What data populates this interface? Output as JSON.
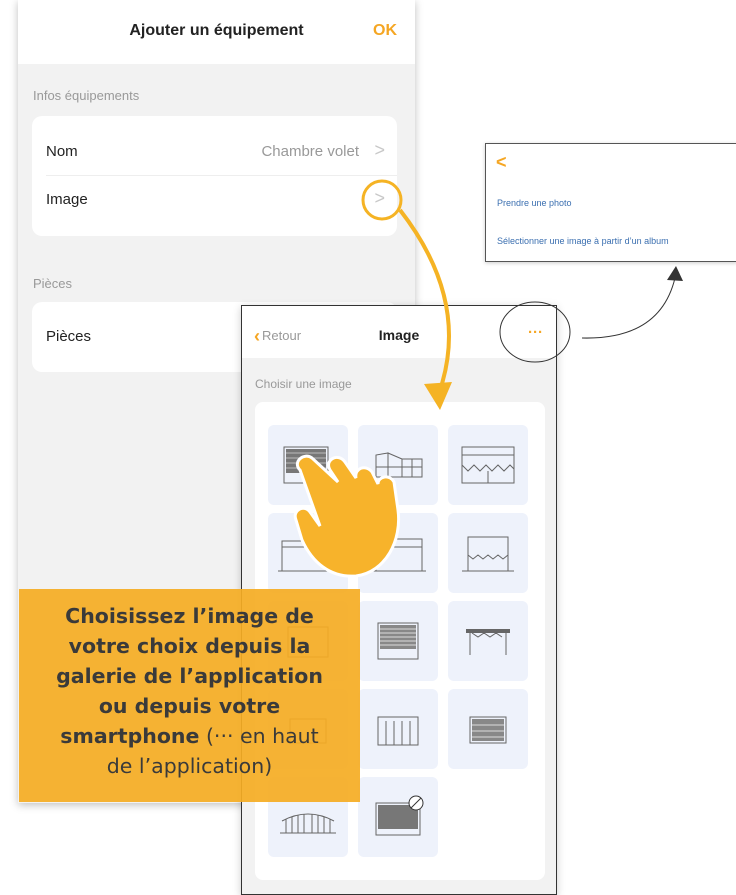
{
  "screen_add": {
    "title": "Ajouter un équipement",
    "ok_label": "OK",
    "section_info": "Infos équipements",
    "name_label": "Nom",
    "name_value": "Chambre volet",
    "image_label": "Image",
    "section_rooms": "Pièces",
    "rooms_label": "Pièces",
    "chevron": ">"
  },
  "screen_image": {
    "back_label": "Retour",
    "title": "Image",
    "more_label": "···",
    "subtitle": "Choisir une image",
    "tiles": [
      "roller-shutter",
      "bay-windows",
      "awning-window",
      "window-with-shutter",
      "sliding-door",
      "awning-low",
      "shutter-left",
      "venetian-blind",
      "pergola",
      "garage-side",
      "garage-sectional",
      "garage-door",
      "gate",
      "screen-no-insect"
    ]
  },
  "screen_photo": {
    "back_label": "<",
    "take_photo": "Prendre une photo",
    "from_album": "Sélectionner une image à partir d’un album"
  },
  "callout": {
    "line1_bold": "Choisissez l’image de",
    "line2_bold": "votre choix depuis la",
    "line3_bold": "galerie de l’application",
    "line4_bold": "ou depuis votre",
    "line5_bold": "smartphone",
    "line5_rest": " (··· en haut",
    "line6": "de l’application)"
  },
  "colors": {
    "accent": "#f5a623",
    "link": "#3b6fb0",
    "tile_bg": "#eef2fb"
  }
}
